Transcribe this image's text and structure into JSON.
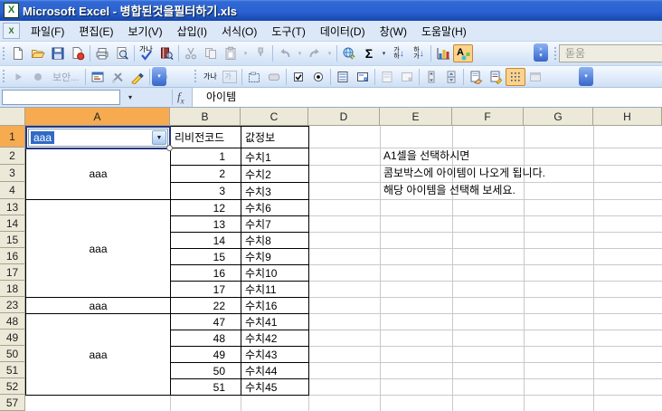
{
  "window": {
    "title": "Microsoft Excel - 병합된것을필터하기.xls"
  },
  "menu": {
    "items": [
      "파일(F)",
      "편집(E)",
      "보기(V)",
      "삽입(I)",
      "서식(O)",
      "도구(T)",
      "데이터(D)",
      "창(W)",
      "도움말(H)"
    ]
  },
  "toolbar": {
    "security_label": "보안...",
    "font_name": "돋움",
    "glyphs": {
      "sigma": "Σ",
      "chev_more": "»",
      "chev_down": "▾",
      "combo_arrow": "▼",
      "spell_kor": "가나",
      "sort_top": "가",
      "sort_bottom": "하",
      "arrow_down": "↓",
      "drawing_a": "A",
      "label_ctrl": "가나",
      "edit_ctrl": "가"
    }
  },
  "formula_bar": {
    "name_box": "",
    "fx": "fx",
    "value": "아이템"
  },
  "sheet": {
    "columns": [
      "A",
      "B",
      "C",
      "D",
      "E",
      "F",
      "G",
      "H"
    ],
    "combo_value": "aaa",
    "header": {
      "b": "리비전코드",
      "c": "값정보"
    },
    "merged": [
      "aaa",
      "aaa",
      "aaa",
      "aaa"
    ],
    "note": [
      "A1셀을 선택하시면",
      "콤보박스에 아이템이 나오게 됩니다.",
      "해당 아이템을 선택해 보세요."
    ],
    "rows": [
      {
        "n": "2",
        "b": "1",
        "c": "수치1"
      },
      {
        "n": "3",
        "b": "2",
        "c": "수치2"
      },
      {
        "n": "4",
        "b": "3",
        "c": "수치3"
      },
      {
        "n": "13",
        "b": "12",
        "c": "수치6"
      },
      {
        "n": "14",
        "b": "13",
        "c": "수치7"
      },
      {
        "n": "15",
        "b": "14",
        "c": "수치8"
      },
      {
        "n": "16",
        "b": "15",
        "c": "수치9"
      },
      {
        "n": "17",
        "b": "16",
        "c": "수치10"
      },
      {
        "n": "18",
        "b": "17",
        "c": "수치11"
      },
      {
        "n": "23",
        "b": "22",
        "c": "수치16"
      },
      {
        "n": "48",
        "b": "47",
        "c": "수치41"
      },
      {
        "n": "49",
        "b": "48",
        "c": "수치42"
      },
      {
        "n": "50",
        "b": "49",
        "c": "수치43"
      },
      {
        "n": "51",
        "b": "50",
        "c": "수치44"
      },
      {
        "n": "52",
        "b": "51",
        "c": "수치45"
      },
      {
        "n": "57",
        "b": "",
        "c": ""
      }
    ]
  }
}
